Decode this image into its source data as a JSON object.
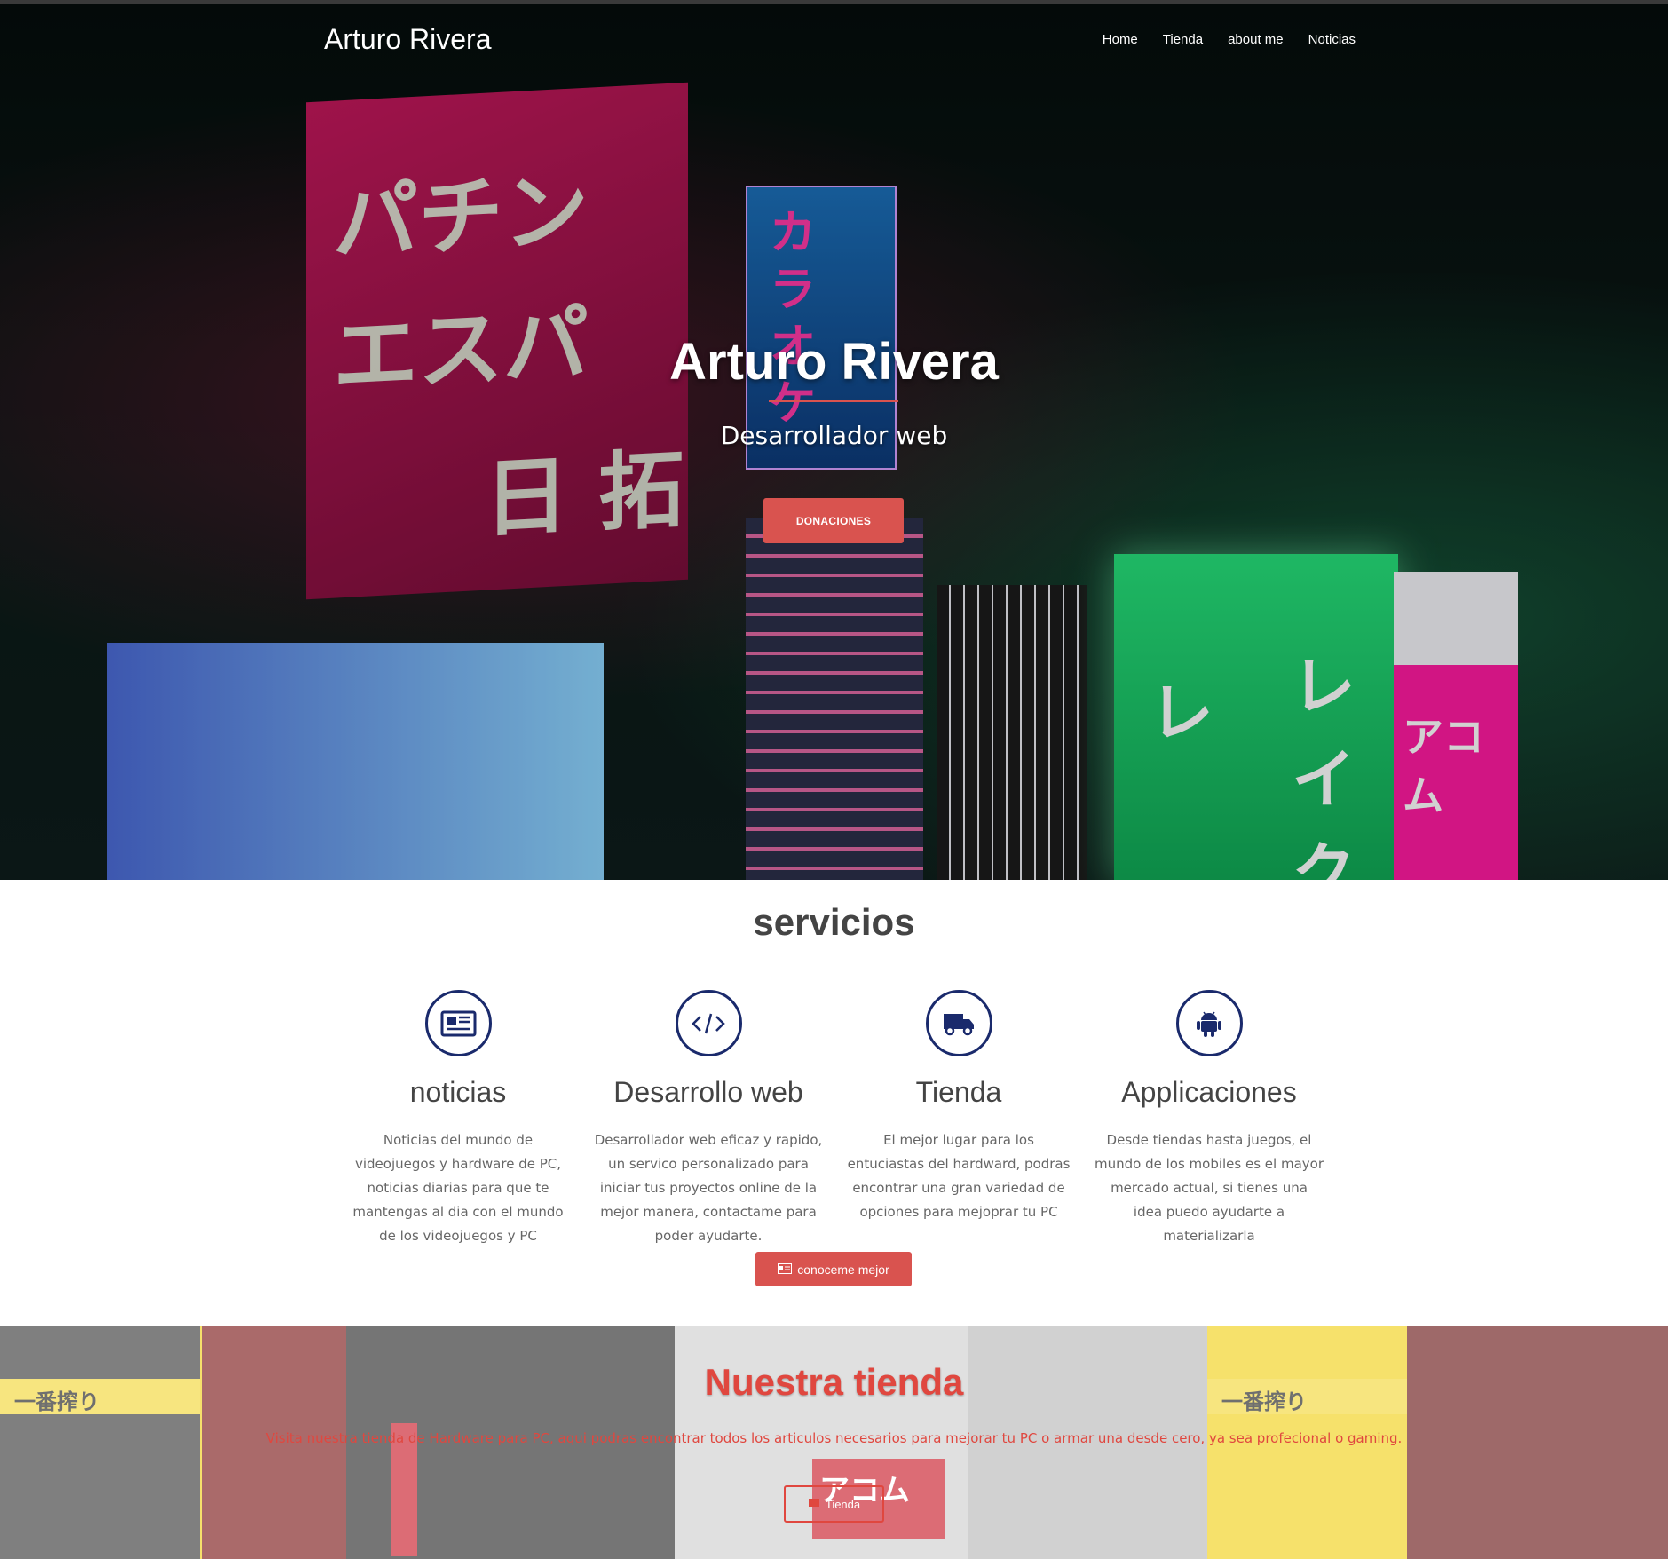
{
  "colors": {
    "accent": "#d9534f",
    "icon_ring": "#1a2a6c",
    "store_text": "#e0473f"
  },
  "header": {
    "brand": "Arturo Rivera",
    "nav": [
      "Home",
      "Tienda",
      "about me",
      "Noticias"
    ]
  },
  "hero": {
    "title": "Arturo Rivera",
    "subtitle": "Desarrollador web",
    "button": "DONACIONES"
  },
  "services": {
    "title": "servicios",
    "items": [
      {
        "icon": "newspaper-icon",
        "name": "noticias",
        "text": "Noticias del mundo de videojuegos y hardware de PC, noticias diarias para que te mantengas al dia con el mundo de los videojuegos y PC"
      },
      {
        "icon": "code-icon",
        "name": "Desarrollo web",
        "text": "Desarrollador web eficaz y rapido, un servico personalizado para iniciar tus proyectos online de la mejor manera, contactame para poder ayudarte."
      },
      {
        "icon": "truck-icon",
        "name": "Tienda",
        "text": "El mejor lugar para los entuciastas del hardward, podras encontrar una gran variedad de opciones para mejoprar tu PC"
      },
      {
        "icon": "android-icon",
        "name": "Applicaciones",
        "text": "Desde tiendas hasta juegos, el mundo de los mobiles es el mayor mercado actual, si tienes una idea puedo ayudarte a materializarla"
      }
    ],
    "button": "conoceme mejor"
  },
  "store": {
    "title": "Nuestra tienda",
    "text": "Visita nuestra tienda de Hardware para PC, aqui podras encontrar todos los articulos necesarios para mejorar tu PC o armar una desde cero, ya sea profecional o gaming.",
    "button": "Tienda"
  }
}
